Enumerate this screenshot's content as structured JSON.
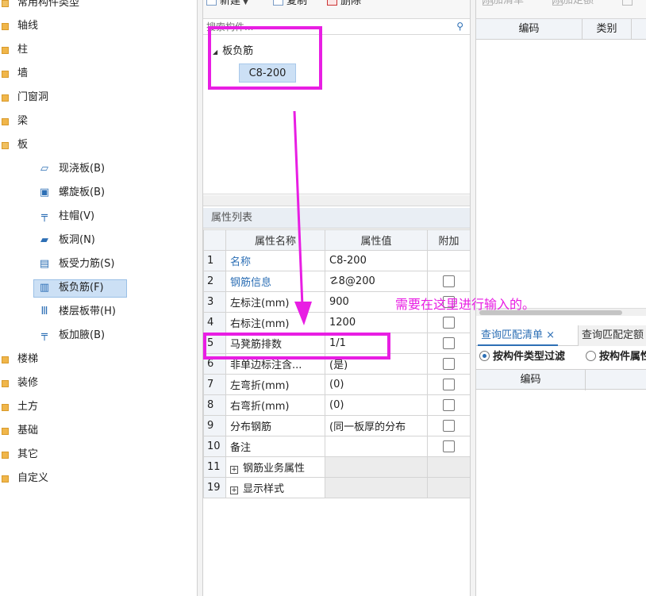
{
  "tree": {
    "header": "常用构件类型",
    "items": [
      {
        "label": "轴线"
      },
      {
        "label": "柱"
      },
      {
        "label": "墙"
      },
      {
        "label": "门窗洞"
      },
      {
        "label": "梁"
      },
      {
        "label": "板"
      }
    ],
    "board_children": [
      {
        "label": "现浇板(B)",
        "icon": "slab-icon"
      },
      {
        "label": "螺旋板(B)",
        "icon": "spiral-slab-icon"
      },
      {
        "label": "柱帽(V)",
        "icon": "column-cap-icon"
      },
      {
        "label": "板洞(N)",
        "icon": "slab-hole-icon"
      },
      {
        "label": "板受力筋(S)",
        "icon": "slab-stress-rebar-icon"
      },
      {
        "label": "板负筋(F)",
        "icon": "slab-negative-rebar-icon"
      },
      {
        "label": "楼层板带(H)",
        "icon": "floor-strip-icon"
      },
      {
        "label": "板加腋(B)",
        "icon": "slab-haunch-icon"
      }
    ],
    "after_items": [
      {
        "label": "楼梯"
      },
      {
        "label": "装修"
      },
      {
        "label": "土方"
      },
      {
        "label": "基础"
      },
      {
        "label": "其它"
      },
      {
        "label": "自定义"
      }
    ]
  },
  "toolbar": {
    "new_label": "新建",
    "copy_label": "复制",
    "delete_label": "删除"
  },
  "search": {
    "placeholder": "搜索构件..."
  },
  "component_tree": {
    "root": "板负筋",
    "child": "C8-200"
  },
  "properties": {
    "title": "属性列表",
    "headers": {
      "name": "属性名称",
      "value": "属性值",
      "extra": "附加"
    },
    "rows": [
      {
        "num": "1",
        "name": "名称",
        "value": "C8-200"
      },
      {
        "num": "2",
        "name": "钢筋信息",
        "value": "☡8@200"
      },
      {
        "num": "3",
        "name": "左标注(mm)",
        "value": "900"
      },
      {
        "num": "4",
        "name": "右标注(mm)",
        "value": "1200"
      },
      {
        "num": "5",
        "name": "马凳筋排数",
        "value": "1/1"
      },
      {
        "num": "6",
        "name": "非单边标注含...",
        "value": "(是)"
      },
      {
        "num": "7",
        "name": "左弯折(mm)",
        "value": "(0)"
      },
      {
        "num": "8",
        "name": "右弯折(mm)",
        "value": "(0)"
      },
      {
        "num": "9",
        "name": "分布钢筋",
        "value": "(同一板厚的分布"
      },
      {
        "num": "10",
        "name": "备注",
        "value": ""
      },
      {
        "num": "11",
        "name": "钢筋业务属性",
        "value": ""
      },
      {
        "num": "19",
        "name": "显示样式",
        "value": ""
      }
    ]
  },
  "right": {
    "toolbar": {
      "add_list": "添加清单",
      "add_quota": "添加定额"
    },
    "columns": {
      "code": "编码",
      "category": "类别"
    },
    "tabs": {
      "match_list": "查询匹配清单",
      "close": "×",
      "match_quota": "查询匹配定额"
    },
    "filters": {
      "by_type": "按构件类型过滤",
      "by_attr": "按构件属性过滤"
    },
    "bottom_columns": {
      "code": "编码"
    }
  },
  "annotation": {
    "note": "需要在这里进行输入的。",
    "color": "#e81ee3"
  }
}
